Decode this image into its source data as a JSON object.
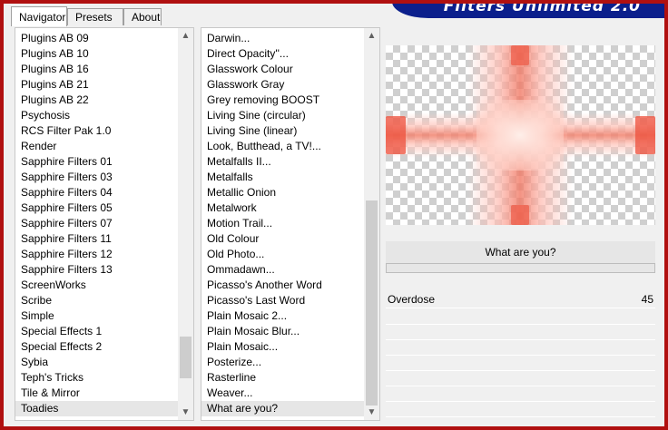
{
  "tabs": [
    {
      "label": "Navigator",
      "active": true
    },
    {
      "label": "Presets",
      "active": false
    },
    {
      "label": "About",
      "active": false
    }
  ],
  "banner": {
    "text": "Filters Unlimited 2.0",
    "color": "#0b1f8c"
  },
  "categories": {
    "items": [
      "Plugins AB 09",
      "Plugins AB 10",
      "Plugins AB 16",
      "Plugins AB 21",
      "Plugins AB 22",
      "Psychosis",
      "RCS Filter Pak 1.0",
      "Render",
      "Sapphire Filters 01",
      "Sapphire Filters 03",
      "Sapphire Filters 04",
      "Sapphire Filters 05",
      "Sapphire Filters 07",
      "Sapphire Filters 11",
      "Sapphire Filters 12",
      "Sapphire Filters 13",
      "ScreenWorks",
      "Scribe",
      "Simple",
      "Special Effects 1",
      "Special Effects 2",
      "Sybia",
      "Teph's Tricks",
      "Tile & Mirror",
      "Toadies"
    ],
    "selected": "Toadies"
  },
  "filters": {
    "items": [
      "Darwin...",
      "Direct Opacity''...",
      "Glasswork Colour",
      "Glasswork Gray",
      "Grey removing BOOST",
      "Living Sine (circular)",
      "Living Sine (linear)",
      "Look, Butthead, a TV!...",
      "Metalfalls II...",
      "Metalfalls",
      "Metallic Onion",
      "Metalwork",
      "Motion Trail...",
      "Old Colour",
      "Old Photo...",
      "Ommadawn...",
      "Picasso's Another Word",
      "Picasso's Last Word",
      "Plain Mosaic 2...",
      "Plain Mosaic Blur...",
      "Plain Mosaic...",
      "Posterize...",
      "Rasterline",
      "Weaver...",
      "What are you?"
    ],
    "selected": "What are you?"
  },
  "preview": {
    "accent": "#ee5040"
  },
  "filter_name": "What are you?",
  "progress": 0,
  "params": [
    {
      "label": "Overdose",
      "value": "45"
    }
  ],
  "empty_param_rows": 7
}
